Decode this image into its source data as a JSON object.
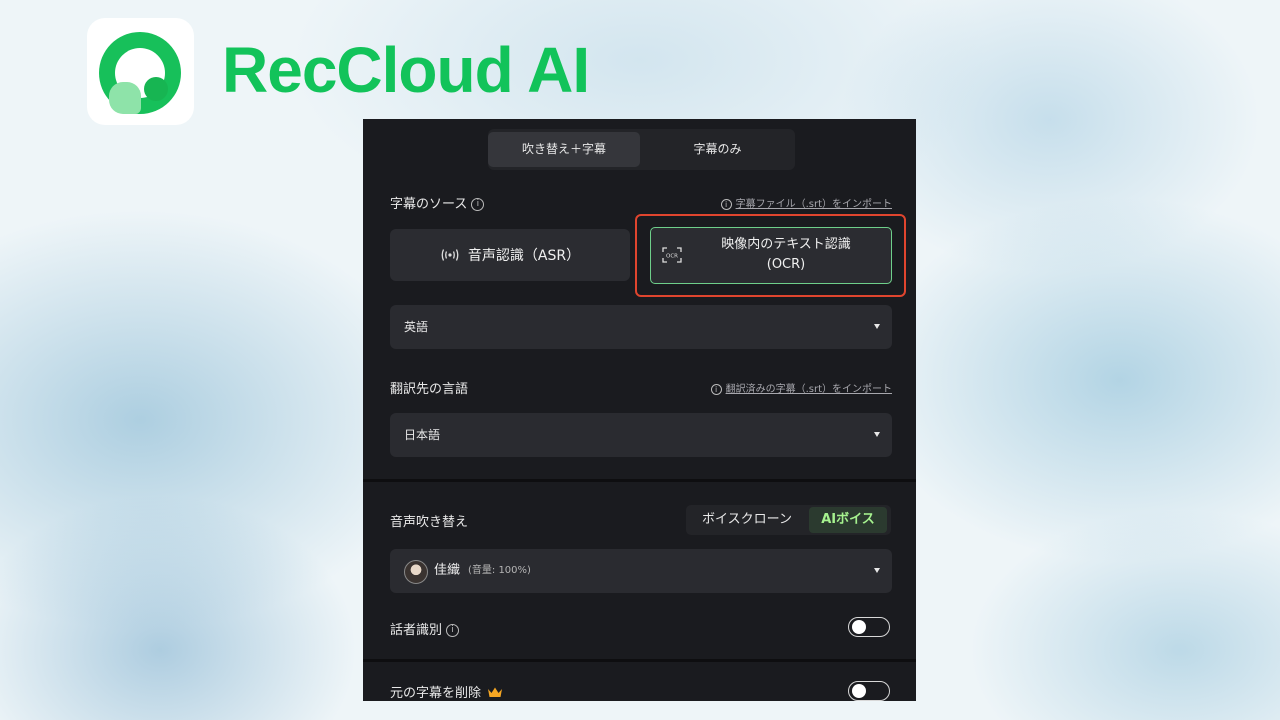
{
  "brand": {
    "name": "RecCloud AI"
  },
  "tabs": [
    {
      "label": "吹き替え＋字幕",
      "active": true
    },
    {
      "label": "字幕のみ",
      "active": false
    }
  ],
  "subtitle_source": {
    "label": "字幕のソース",
    "import_link": "字幕ファイル（.srt）をインポート",
    "asr_label": "音声認識（ASR）",
    "ocr_label_line1": "映像内のテキスト認識",
    "ocr_label_line2": "(OCR)",
    "ocr_icon_text": "OCR",
    "language_value": "英語"
  },
  "target_language": {
    "label": "翻訳先の言語",
    "import_link": "翻訳済みの字幕（.srt）をインポート",
    "value": "日本語"
  },
  "dubbing": {
    "label": "音声吹き替え",
    "options": [
      {
        "label": "ボイスクローン",
        "active": false
      },
      {
        "label": "AIボイス",
        "active": true
      }
    ],
    "voice_name": "佳織",
    "voice_volume": "(音量: 100%)"
  },
  "speaker_id": {
    "label": "話者識別",
    "enabled": false
  },
  "remove_original": {
    "label": "元の字幕を削除",
    "enabled": false
  },
  "colors": {
    "brand_green": "#12c35a",
    "highlight_red": "#e0452e",
    "accent_green": "#a6f28f"
  }
}
